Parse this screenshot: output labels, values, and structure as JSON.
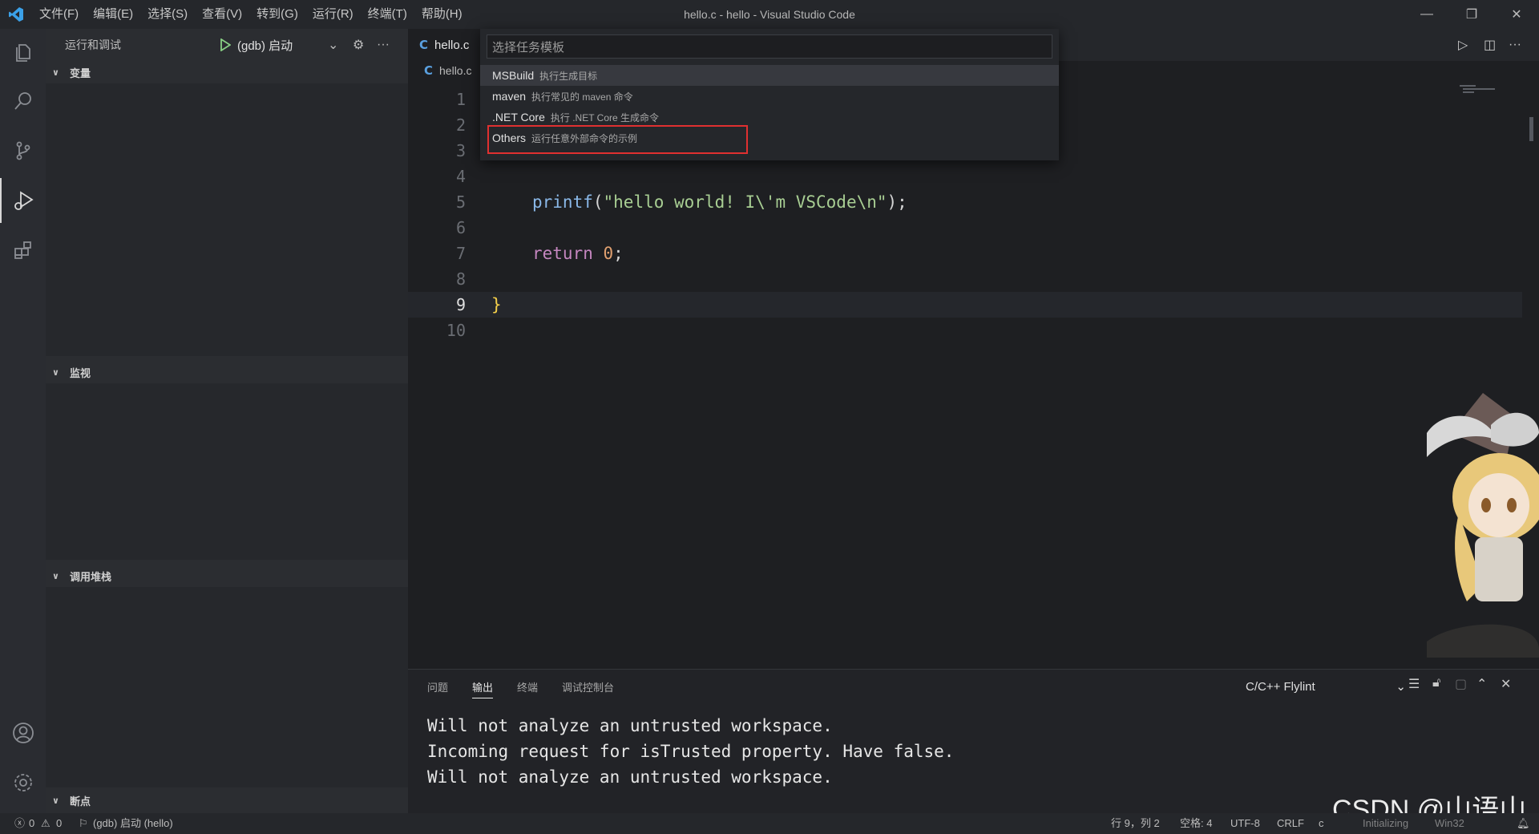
{
  "titlebar": {
    "menu": [
      "文件(F)",
      "编辑(E)",
      "选择(S)",
      "查看(V)",
      "转到(G)",
      "运行(R)",
      "终端(T)",
      "帮助(H)"
    ],
    "window_title": "hello.c - hello - Visual Studio Code"
  },
  "sidebar": {
    "title": "运行和调试",
    "run_config": "(gdb) 启动",
    "sections": {
      "variables": "变量",
      "watch": "监视",
      "callstack": "调用堆栈",
      "breakpoints": "断点"
    }
  },
  "editor": {
    "tab_label": "hello.c",
    "breadcrumb": "hello.c",
    "lines": [
      {
        "n": "1"
      },
      {
        "n": "2"
      },
      {
        "n": "3"
      },
      {
        "n": "4"
      },
      {
        "n": "5",
        "code": "printf(\"hello world! I\\'m VSCode\\n\");"
      },
      {
        "n": "6"
      },
      {
        "n": "7",
        "code": "return 0;"
      },
      {
        "n": "8"
      },
      {
        "n": "9",
        "code": "}"
      },
      {
        "n": "10"
      }
    ],
    "line5": {
      "fn": "printf",
      "open": "(",
      "str": "\"hello world! I\\'m VSCode\\n\"",
      "close": ");"
    },
    "line7": {
      "kw": "return",
      "num": "0",
      "semi": ";"
    },
    "line9": {
      "brace": "}"
    }
  },
  "quickpick": {
    "placeholder": "选择任务模板",
    "items": [
      {
        "label": "MSBuild",
        "desc": "执行生成目标"
      },
      {
        "label": "maven",
        "desc": "执行常见的 maven 命令"
      },
      {
        "label": ".NET Core",
        "desc": "执行 .NET Core 生成命令"
      },
      {
        "label": "Others",
        "desc": "运行任意外部命令的示例"
      }
    ]
  },
  "panel": {
    "tabs": [
      "问题",
      "输出",
      "终端",
      "调试控制台"
    ],
    "active_tab": "输出",
    "channel": "C/C++ Flylint",
    "output": [
      "Will not analyze an untrusted workspace.",
      "Incoming request for isTrusted property. Have false.",
      "Will not analyze an untrusted workspace."
    ]
  },
  "statusbar": {
    "errors": "0",
    "warnings": "0",
    "debug": "(gdb) 启动 (hello)",
    "position": "行 9，列 2",
    "spaces": "空格: 4",
    "encoding": "UTF-8",
    "eol": "CRLF",
    "language": "c",
    "initializing": "Initializing",
    "platform": "Win32"
  },
  "watermark": "CSDN @山语山",
  "colors": {
    "accent_red": "#e03030",
    "string": "#a8ce93",
    "keyword": "#c586c0",
    "function": "#8ab8e8"
  }
}
